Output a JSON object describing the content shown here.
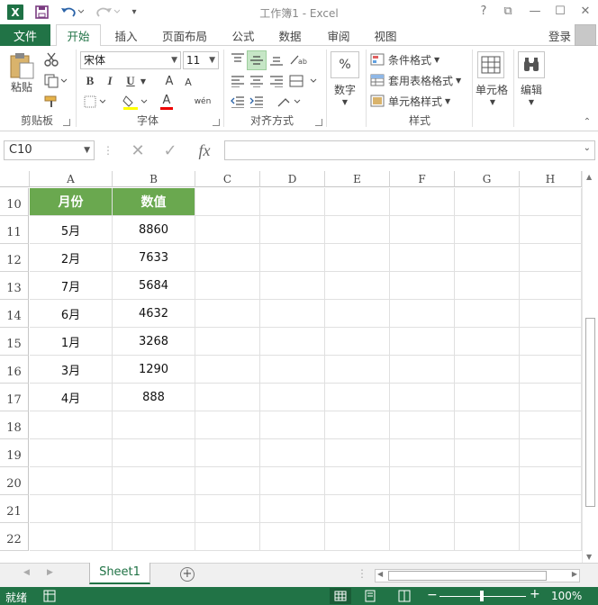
{
  "app": {
    "title": "工作簿1 - Excel"
  },
  "quick_access": {
    "logo": "X",
    "save_icon": "save-icon",
    "undo_icon": "undo-icon",
    "redo_icon": "redo-icon"
  },
  "window_controls": {
    "help": "?",
    "restore_ribbon": "⧉",
    "minimize": "—",
    "maximize": "☐",
    "close": "✕"
  },
  "tabs": [
    "文件",
    "开始",
    "插入",
    "页面布局",
    "公式",
    "数据",
    "审阅",
    "视图"
  ],
  "active_tab": "开始",
  "login": "登录",
  "ribbon": {
    "clipboard": {
      "paste_label": "粘贴",
      "group_label": "剪贴板"
    },
    "font": {
      "font_name": "宋体",
      "font_size": "11",
      "bold": "B",
      "italic": "I",
      "underline": "U",
      "grow": "A",
      "shrink": "A",
      "font_color": "A",
      "phonetic": "wén",
      "group_label": "字体"
    },
    "alignment": {
      "group_label": "对齐方式"
    },
    "number": {
      "label": "数字",
      "symbol": "%"
    },
    "styles": {
      "conditional": "条件格式",
      "table": "套用表格格式",
      "cell_styles": "单元格样式",
      "group_label": "样式"
    },
    "cells": {
      "label": "单元格"
    },
    "editing": {
      "label": "编辑"
    }
  },
  "formula_bar": {
    "name_box": "C10",
    "cancel": "✕",
    "enter": "✓",
    "fx": "fx",
    "value": ""
  },
  "columns": [
    "A",
    "B",
    "C",
    "D",
    "E",
    "F",
    "G",
    "H"
  ],
  "rows": [
    "10",
    "11",
    "12",
    "13",
    "14",
    "15",
    "16",
    "17",
    "18",
    "19",
    "20",
    "21",
    "22"
  ],
  "table": {
    "headers": [
      "月份",
      "数值"
    ],
    "data": [
      [
        "5月",
        "8860"
      ],
      [
        "2月",
        "7633"
      ],
      [
        "7月",
        "5684"
      ],
      [
        "6月",
        "4632"
      ],
      [
        "1月",
        "3268"
      ],
      [
        "3月",
        "1290"
      ],
      [
        "4月",
        "888"
      ]
    ]
  },
  "sheets": [
    "Sheet1"
  ],
  "status": {
    "ready": "就绪",
    "zoom": "100%"
  },
  "colors": {
    "brand": "#217346",
    "header_fill": "#6aa84f"
  }
}
